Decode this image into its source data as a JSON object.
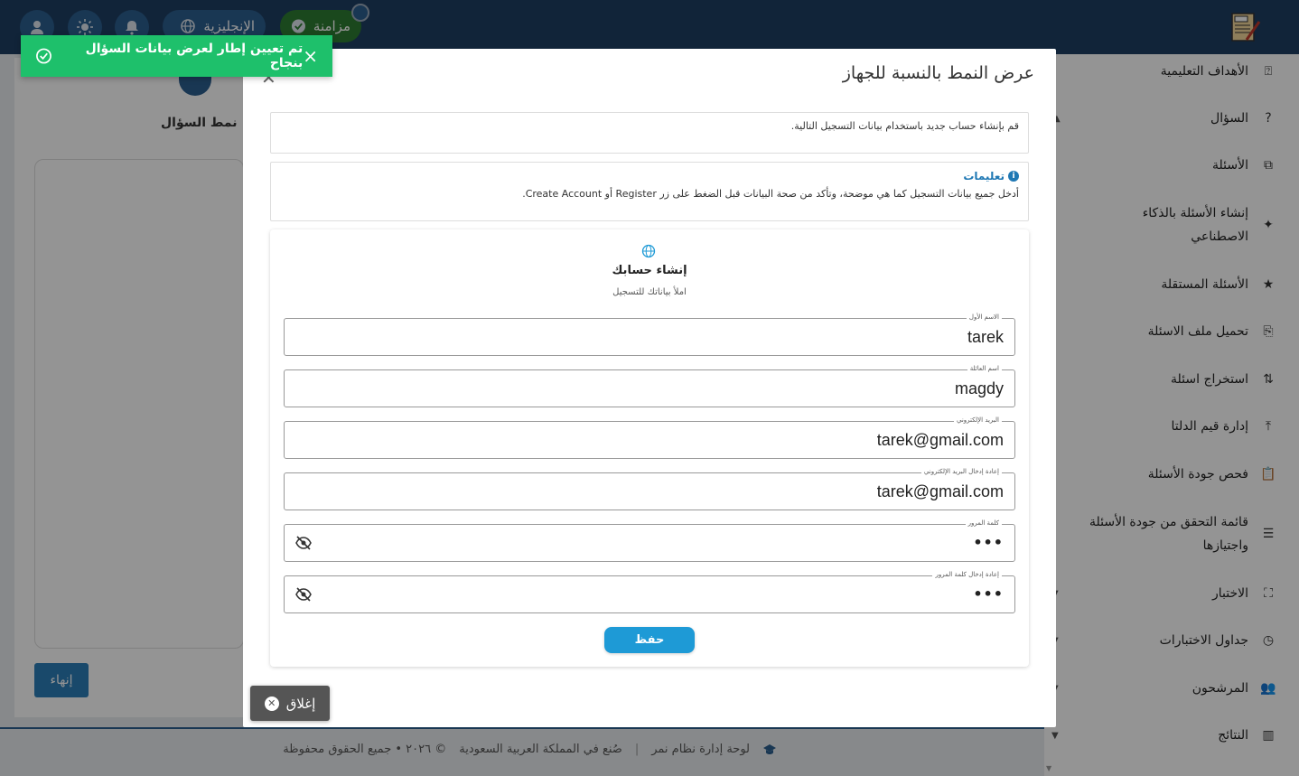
{
  "topbar": {
    "language_label": "الإنجليزية",
    "sync_label": "مزامنة",
    "icons": [
      "user-icon",
      "brightness-icon",
      "bell-icon",
      "globe-icon",
      "check-icon"
    ],
    "colors": {
      "bar": "#1e3f63",
      "pill": "#2c5f8f",
      "sync": "#2e7d32"
    }
  },
  "toast": {
    "message": "تم تعيين إطار لعرض بيانات السؤال بنجاح",
    "close": "×",
    "color": "#1ec06b"
  },
  "sidebar": {
    "items": [
      {
        "label": "الأهداف التعليمية",
        "icon": "objectives-icon",
        "glyph": "⍰"
      },
      {
        "label": "السؤال",
        "icon": "question-icon",
        "glyph": "?",
        "caret": "▲"
      },
      {
        "label": "الأسئلة",
        "icon": "questions-icon",
        "glyph": "⧉"
      },
      {
        "label": "إنشاء الأسئلة بالذكاء الاصطناعي",
        "icon": "sparkle-icon",
        "glyph": "✦"
      },
      {
        "label": "الأسئلة المستقلة",
        "icon": "star-icon",
        "glyph": "★"
      },
      {
        "label": "تحميل ملف الاسئلة",
        "icon": "file-upload-icon",
        "glyph": "⎘"
      },
      {
        "label": "استخراج اسئلة",
        "icon": "swap-icon",
        "glyph": "⇅"
      },
      {
        "label": "إدارة قيم الدلتا",
        "icon": "upload-icon",
        "glyph": "⤒"
      },
      {
        "label": "فحص جودة الأسئلة",
        "icon": "clipboard-icon",
        "glyph": "📋"
      },
      {
        "label": "قائمة التحقق من جودة الأسئلة واجتيازها",
        "icon": "checklist-icon",
        "glyph": "☰"
      },
      {
        "label": "الاختبار",
        "icon": "exam-icon",
        "glyph": "⛶",
        "caret": "▼"
      },
      {
        "label": "جداول الاختبارات",
        "icon": "clock-icon",
        "glyph": "◷",
        "caret": "▼"
      },
      {
        "label": "المرشحون",
        "icon": "group-icon",
        "glyph": "👥",
        "caret": "▼"
      },
      {
        "label": "النتائج",
        "icon": "chart-icon",
        "glyph": "▥",
        "caret": "▼"
      }
    ]
  },
  "main": {
    "step_title": "نمط السؤال",
    "finish_label": "إنهاء"
  },
  "footer": {
    "brand": "لوحة إدارة نظام نمر",
    "made_in": "صُنع في المملكة العربية السعودية",
    "copyright": "© ٢٠٢٦ • جميع الحقوق محفوظة"
  },
  "modal": {
    "title": "عرض النمط بالنسبة للجهاز",
    "description": "قم بإنشاء حساب جديد باستخدام بيانات التسجيل التالية.",
    "instructions_title": "تعليمات",
    "instructions_text": "أدخل جميع بيانات التسجيل كما هي موضحة، وتأكد من صحة البيانات قبل الضغط على زر Register أو Create Account.",
    "form": {
      "title": "إنشاء حسابك",
      "subtitle": "املأ بياناتك للتسجيل",
      "fields": [
        {
          "label": "الاسم الأول",
          "value": "tarek"
        },
        {
          "label": "اسم العائلة",
          "value": "magdy"
        },
        {
          "label": "البريد الإلكتروني",
          "value": "tarek@gmail.com"
        },
        {
          "label": "إعادة إدخال البريد الإلكتروني",
          "value": "tarek@gmail.com"
        },
        {
          "label": "كلمة المرور",
          "value": "•••"
        },
        {
          "label": "إعادة إدخال كلمة المرور",
          "value": "•••"
        }
      ],
      "save_label": "حفظ",
      "save_color": "#1e9ad6"
    },
    "close_label": "إغلاق"
  }
}
